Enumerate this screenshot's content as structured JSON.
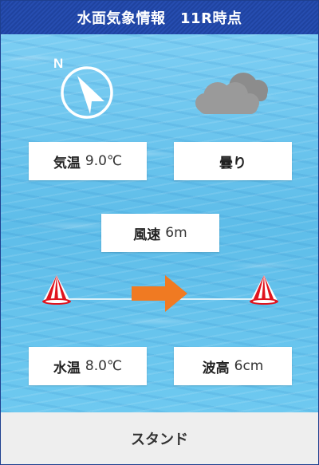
{
  "header": {
    "title": "水面気象情報　11R時点"
  },
  "compass": {
    "north_label": "N",
    "icon": "wind-direction-compass-icon"
  },
  "weather_icon": "cloudy-icon",
  "temperature": {
    "label": "気温",
    "value": "9.0℃"
  },
  "weather": {
    "label": "曇り"
  },
  "wind_speed": {
    "label": "風速",
    "value": "6m"
  },
  "wind_direction_icon": "arrow-right-icon",
  "water_temperature": {
    "label": "水温",
    "value": "8.0℃"
  },
  "wave_height": {
    "label": "波高",
    "value": "6cm"
  },
  "footer": {
    "label": "スタンド"
  },
  "colors": {
    "header_bg": "#1f43a0",
    "water": "#6ec6ee",
    "arrow": "#f07a22",
    "buoy_red": "#e0141e",
    "footer_bg": "#eeeeee"
  }
}
